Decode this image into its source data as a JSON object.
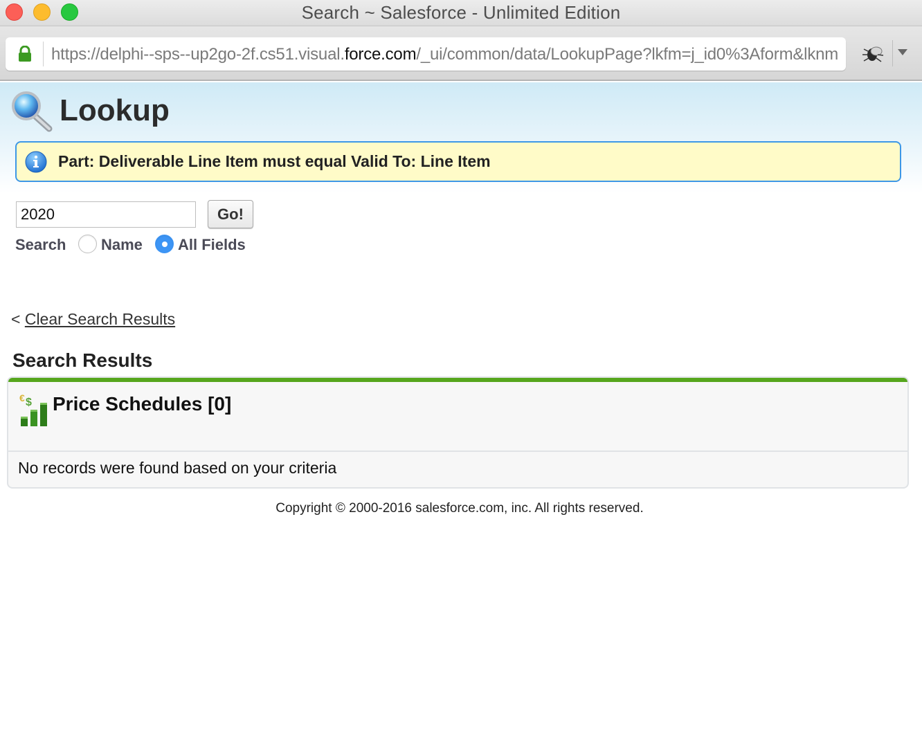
{
  "window": {
    "title": "Search ~ Salesforce - Unlimited Edition"
  },
  "browser": {
    "url_prefix": "https://delphi--sps--up2go-2f.cs51.visual.",
    "url_host": "force.com",
    "url_suffix": "/_ui/common/data/LookupPage?lkfm=j_id0%3Aform&lknm"
  },
  "page": {
    "title": "Lookup",
    "message": "Part: Deliverable Line Item must equal Valid To: Line Item",
    "search": {
      "value": "2020",
      "go_label": "Go!",
      "label": "Search",
      "options": [
        {
          "label": "Name",
          "checked": false
        },
        {
          "label": "All Fields",
          "checked": true
        }
      ]
    },
    "clear_prefix": "<",
    "clear_link": "Clear Search Results",
    "results_heading": "Search Results",
    "results": {
      "object_title": "Price Schedules [0]",
      "empty_message": "No records were found based on your criteria"
    },
    "footer": "Copyright © 2000-2016 salesforce.com, inc. All rights reserved."
  },
  "colors": {
    "message_border": "#3d97e6",
    "message_bg": "#fffbc8",
    "results_accent": "#56a61d",
    "radio_selected": "#3d95f5"
  }
}
